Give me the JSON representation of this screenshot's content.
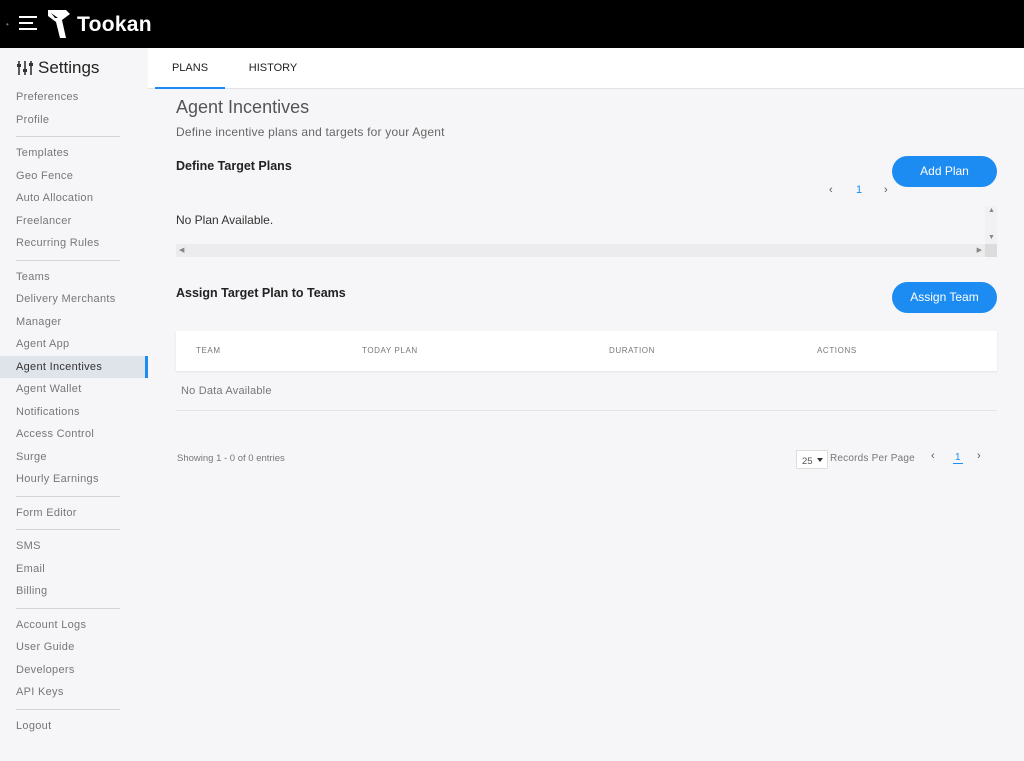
{
  "app": {
    "brand": "Tookan"
  },
  "sidebar": {
    "title": "Settings",
    "groups": [
      [
        "Preferences",
        "Profile"
      ],
      [
        "Templates",
        "Geo Fence",
        "Auto Allocation",
        "Freelancer",
        "Recurring Rules"
      ],
      [
        "Teams",
        "Delivery Merchants",
        "Manager",
        "Agent App",
        "Agent Incentives",
        "Agent Wallet",
        "Notifications",
        "Access Control",
        "Surge",
        "Hourly Earnings"
      ],
      [
        "Form Editor"
      ],
      [
        "SMS",
        "Email",
        "Billing"
      ],
      [
        "Account Logs",
        "User Guide",
        "Developers",
        "API Keys"
      ],
      [
        "Logout"
      ]
    ],
    "active": "Agent Incentives"
  },
  "tabs": [
    {
      "label": "PLANS",
      "active": true
    },
    {
      "label": "HISTORY",
      "active": false
    }
  ],
  "page": {
    "title": "Agent Incentives",
    "subtitle": "Define incentive plans and targets for your Agent"
  },
  "plans": {
    "heading": "Define Target Plans",
    "add_button": "Add Plan",
    "page": "1",
    "empty": "No Plan Available."
  },
  "assign": {
    "heading": "Assign Target Plan to Teams",
    "assign_button": "Assign Team",
    "columns": [
      "TEAM",
      "TODAY PLAN",
      "DURATION",
      "ACTIONS"
    ],
    "empty": "No Data Available"
  },
  "footer": {
    "showing": "Showing 1 - 0 of 0 entries",
    "per_page": "25",
    "records_label": "Records Per Page",
    "page": "1"
  },
  "colors": {
    "accent": "#1c8cf2",
    "topbar": "#000000"
  },
  "icons": [
    "menu-icon",
    "tookan-logo-icon",
    "settings-sliders-icon",
    "chevron-left-icon",
    "chevron-right-icon",
    "caret-down-icon"
  ]
}
